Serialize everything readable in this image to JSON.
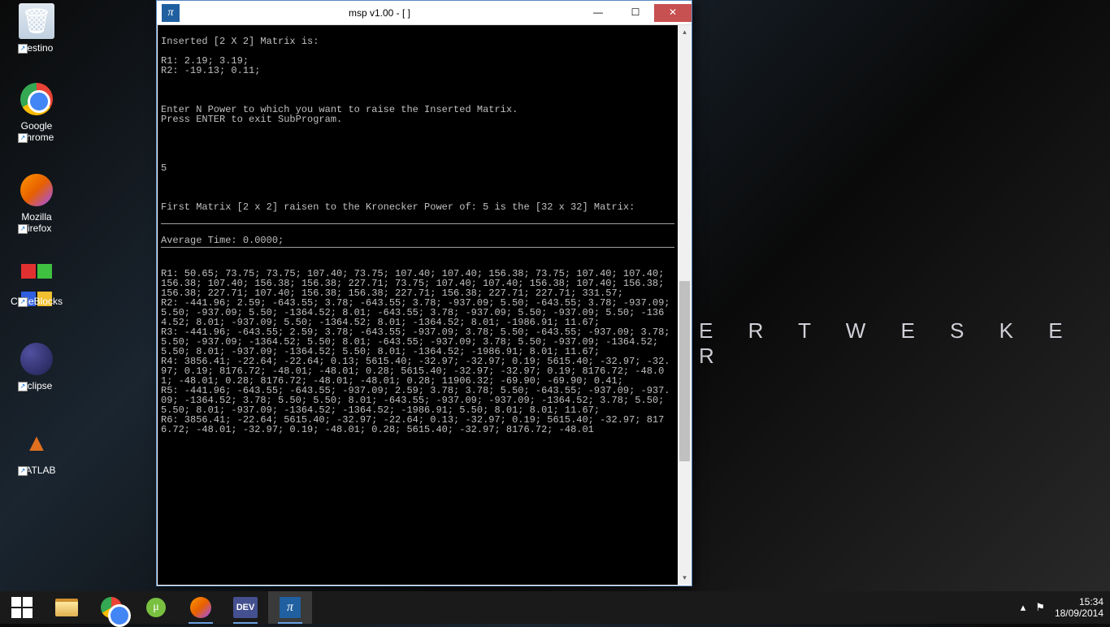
{
  "wallpaper_text": "E R T   W E S K E R",
  "desktop": {
    "recycle": "Cestino",
    "chrome": "Google Chrome",
    "firefox": "Mozilla Firefox",
    "codeblocks": "CodeBlocks",
    "eclipse": "Eclipse",
    "matlab": "MATLAB"
  },
  "window": {
    "title": "msp v1.00 - [  ]",
    "icon_char": "π"
  },
  "console": {
    "header": "Inserted [2 X 2] Matrix is:",
    "r1": "R1: 2.19; 3.19;",
    "r2": "R2: -19.13; 0.11;",
    "prompt1": "Enter N Power to which you want to raise the Inserted Matrix.",
    "prompt2": "Press ENTER to exit SubProgram.",
    "input_n": "5",
    "result_header": "First Matrix [2 x 2] raisen to the Kronecker Power of: 5 is the [32 x 32] Matrix:",
    "avg_time": "Average Time: 0.0000;",
    "rows": [
      "R1: 50.65; 73.75; 73.75; 107.40; 73.75; 107.40; 107.40; 156.38; 73.75; 107.40; 107.40; 156.38; 107.40; 156.38; 156.38; 227.71; 73.75; 107.40; 107.40; 156.38; 107.40; 156.38; 156.38; 227.71; 107.40; 156.38; 156.38; 227.71; 156.38; 227.71; 227.71; 331.57;",
      "R2: -441.96; 2.59; -643.55; 3.78; -643.55; 3.78; -937.09; 5.50; -643.55; 3.78; -937.09; 5.50; -937.09; 5.50; -1364.52; 8.01; -643.55; 3.78; -937.09; 5.50; -937.09; 5.50; -1364.52; 8.01; -937.09; 5.50; -1364.52; 8.01; -1364.52; 8.01; -1986.91; 11.67;",
      "R3: -441.96; -643.55; 2.59; 3.78; -643.55; -937.09; 3.78; 5.50; -643.55; -937.09; 3.78; 5.50; -937.09; -1364.52; 5.50; 8.01; -643.55; -937.09; 3.78; 5.50; -937.09; -1364.52; 5.50; 8.01; -937.09; -1364.52; 5.50; 8.01; -1364.52; -1986.91; 8.01; 11.67;",
      "R4: 3856.41; -22.64; -22.64; 0.13; 5615.40; -32.97; -32.97; 0.19; 5615.40; -32.97; -32.97; 0.19; 8176.72; -48.01; -48.01; 0.28; 5615.40; -32.97; -32.97; 0.19; 8176.72; -48.01; -48.01; 0.28; 8176.72; -48.01; -48.01; 0.28; 11906.32; -69.90; -69.90; 0.41;",
      "R5: -441.96; -643.55; -643.55; -937.09; 2.59; 3.78; 3.78; 5.50; -643.55; -937.09; -937.09; -1364.52; 3.78; 5.50; 5.50; 8.01; -643.55; -937.09; -937.09; -1364.52; 3.78; 5.50; 5.50; 8.01; -937.09; -1364.52; -1364.52; -1986.91; 5.50; 8.01; 8.01; 11.67;",
      "R6: 3856.41; -22.64; 5615.40; -32.97; -22.64; 0.13; -32.97; 0.19; 5615.40; -32.97; 8176.72; -48.01; -32.97; 0.19; -48.01; 0.28; 5615.40; -32.97; 8176.72; -48.01"
    ]
  },
  "chart_data": {
    "type": "table",
    "title": "Inserted [2 X 2] Matrix",
    "input_matrix": [
      [
        2.19,
        3.19
      ],
      [
        -19.13,
        0.11
      ]
    ],
    "kronecker_power": 5,
    "output_dim": [
      32,
      32
    ],
    "average_time": 0.0
  },
  "taskbar": {
    "dev_label": "DEV",
    "utorrent_char": "μ"
  },
  "tray": {
    "up_icon": "▴",
    "flag_icon": "⚑",
    "time": "15:34",
    "date": "18/09/2014"
  }
}
